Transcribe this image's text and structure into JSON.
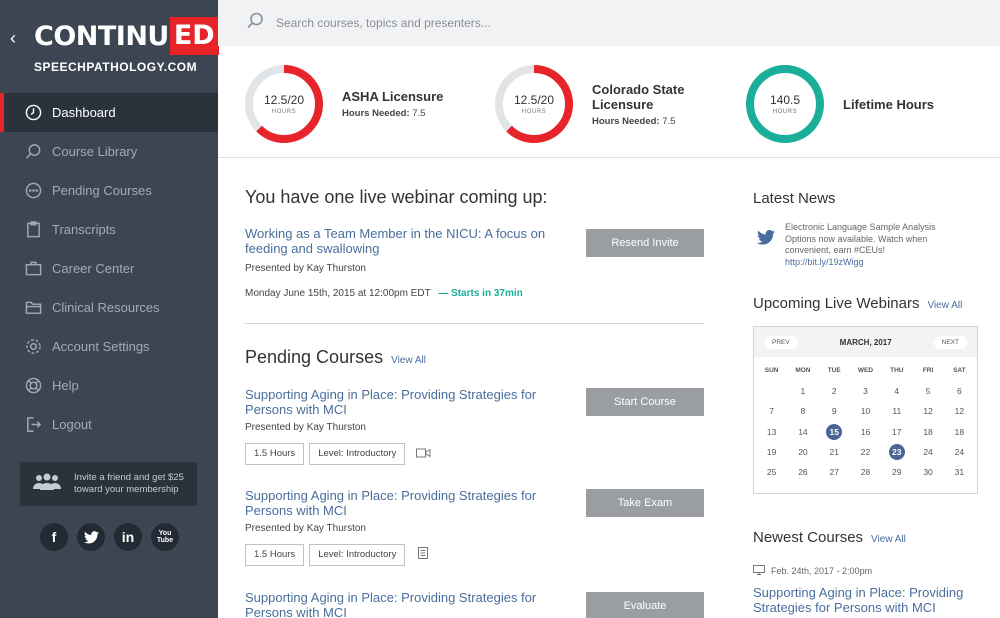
{
  "brand": {
    "logo_main": "CONTINU",
    "logo_ed": "ED",
    "subtitle": "SPEECHPATHOLOGY.COM",
    "accent": "#e8242b"
  },
  "search": {
    "placeholder": "Search courses, topics and presenters..."
  },
  "nav": [
    {
      "label": "Dashboard",
      "icon": "clock-icon",
      "active": true
    },
    {
      "label": "Course Library",
      "icon": "search-icon"
    },
    {
      "label": "Pending Courses",
      "icon": "dots-circle-icon"
    },
    {
      "label": "Transcripts",
      "icon": "clipboard-icon"
    },
    {
      "label": "Career Center",
      "icon": "briefcase-icon"
    },
    {
      "label": "Clinical Resources",
      "icon": "folder-icon"
    },
    {
      "label": "Account Settings",
      "icon": "gear-icon"
    },
    {
      "label": "Help",
      "icon": "lifebuoy-icon"
    },
    {
      "label": "Logout",
      "icon": "logout-icon"
    }
  ],
  "invite": {
    "text": "Invite a friend and get $25 toward your membership"
  },
  "social": [
    "f",
    "t",
    "in",
    "You Tube"
  ],
  "stats": [
    {
      "value": "12.5/20",
      "unit": "HOURS",
      "title": "ASHA Licensure",
      "needed_label": "Hours Needed:",
      "needed": "7.5",
      "progress": 0.625,
      "color": "#e8242b"
    },
    {
      "value": "12.5/20",
      "unit": "HOURS",
      "title": "Colorado State Licensure",
      "needed_label": "Hours Needed:",
      "needed": "7.5",
      "progress": 0.625,
      "color": "#e8242b"
    },
    {
      "value": "140.5",
      "unit": "HOURS",
      "title": "Lifetime Hours",
      "progress": 1.0,
      "color": "#1aaf9a"
    }
  ],
  "webinar": {
    "heading": "You have one live webinar coming up:",
    "title": "Working as a Team Member in the NICU: A focus on feeding and swallowing",
    "presenter": "Presented by Kay Thurston",
    "datetime": "Monday June 15th, 2015 at 12:00pm EDT",
    "starts": "— Starts in 37min",
    "button": "Resend Invite"
  },
  "pending": {
    "heading": "Pending Courses",
    "view_all": "View All",
    "courses": [
      {
        "title": "Supporting Aging in Place: Providing Strategies for Persons with MCI",
        "presenter": "Presented by Kay Thurston",
        "hours": "1.5 Hours",
        "level": "Level: Introductory",
        "format_icon": "video-icon",
        "button": "Start Course"
      },
      {
        "title": "Supporting Aging in Place: Providing Strategies for Persons with MCI",
        "presenter": "Presented by Kay Thurston",
        "hours": "1.5 Hours",
        "level": "Level: Introductory",
        "format_icon": "document-icon",
        "button": "Take Exam"
      },
      {
        "title": "Supporting Aging in Place: Providing Strategies for Persons with MCI",
        "button": "Evaluate"
      }
    ]
  },
  "news": {
    "heading": "Latest News",
    "text": "Electronic Language Sample Analysis Options now available. Watch when convenient, earn #CEUs!",
    "link": "http://bit.ly/19zWigg"
  },
  "upcoming": {
    "heading": "Upcoming Live Webinars",
    "view_all": "View All",
    "prev": "PREV",
    "next": "NEXT",
    "month": "MARCH, 2017",
    "dow": [
      "SUN",
      "MON",
      "TUE",
      "WED",
      "THU",
      "FRI",
      "SAT"
    ],
    "weeks": [
      [
        "",
        "1",
        "2",
        "3",
        "4",
        "5",
        "6"
      ],
      [
        "7",
        "8",
        "9",
        "10",
        "11",
        "12",
        "12"
      ],
      [
        "13",
        "14",
        "15",
        "16",
        "17",
        "18",
        "18"
      ],
      [
        "19",
        "20",
        "21",
        "22",
        "23",
        "24",
        "24"
      ],
      [
        "25",
        "26",
        "27",
        "28",
        "29",
        "30",
        "31"
      ]
    ],
    "highlighted": [
      "15",
      "23"
    ],
    "highlight_color": "#4a6596"
  },
  "newest": {
    "heading": "Newest Courses",
    "view_all": "View All",
    "date": "Feb. 24th, 2017 - 2:00pm",
    "title": "Supporting Aging in Place: Providing Strategies for Persons with MCI"
  },
  "colors": {
    "sidebar": "#3c4652",
    "sidebar_active": "#2a323c",
    "link": "#4a6e9d",
    "button": "#9a9ea3",
    "teal": "#1aaf9a"
  }
}
